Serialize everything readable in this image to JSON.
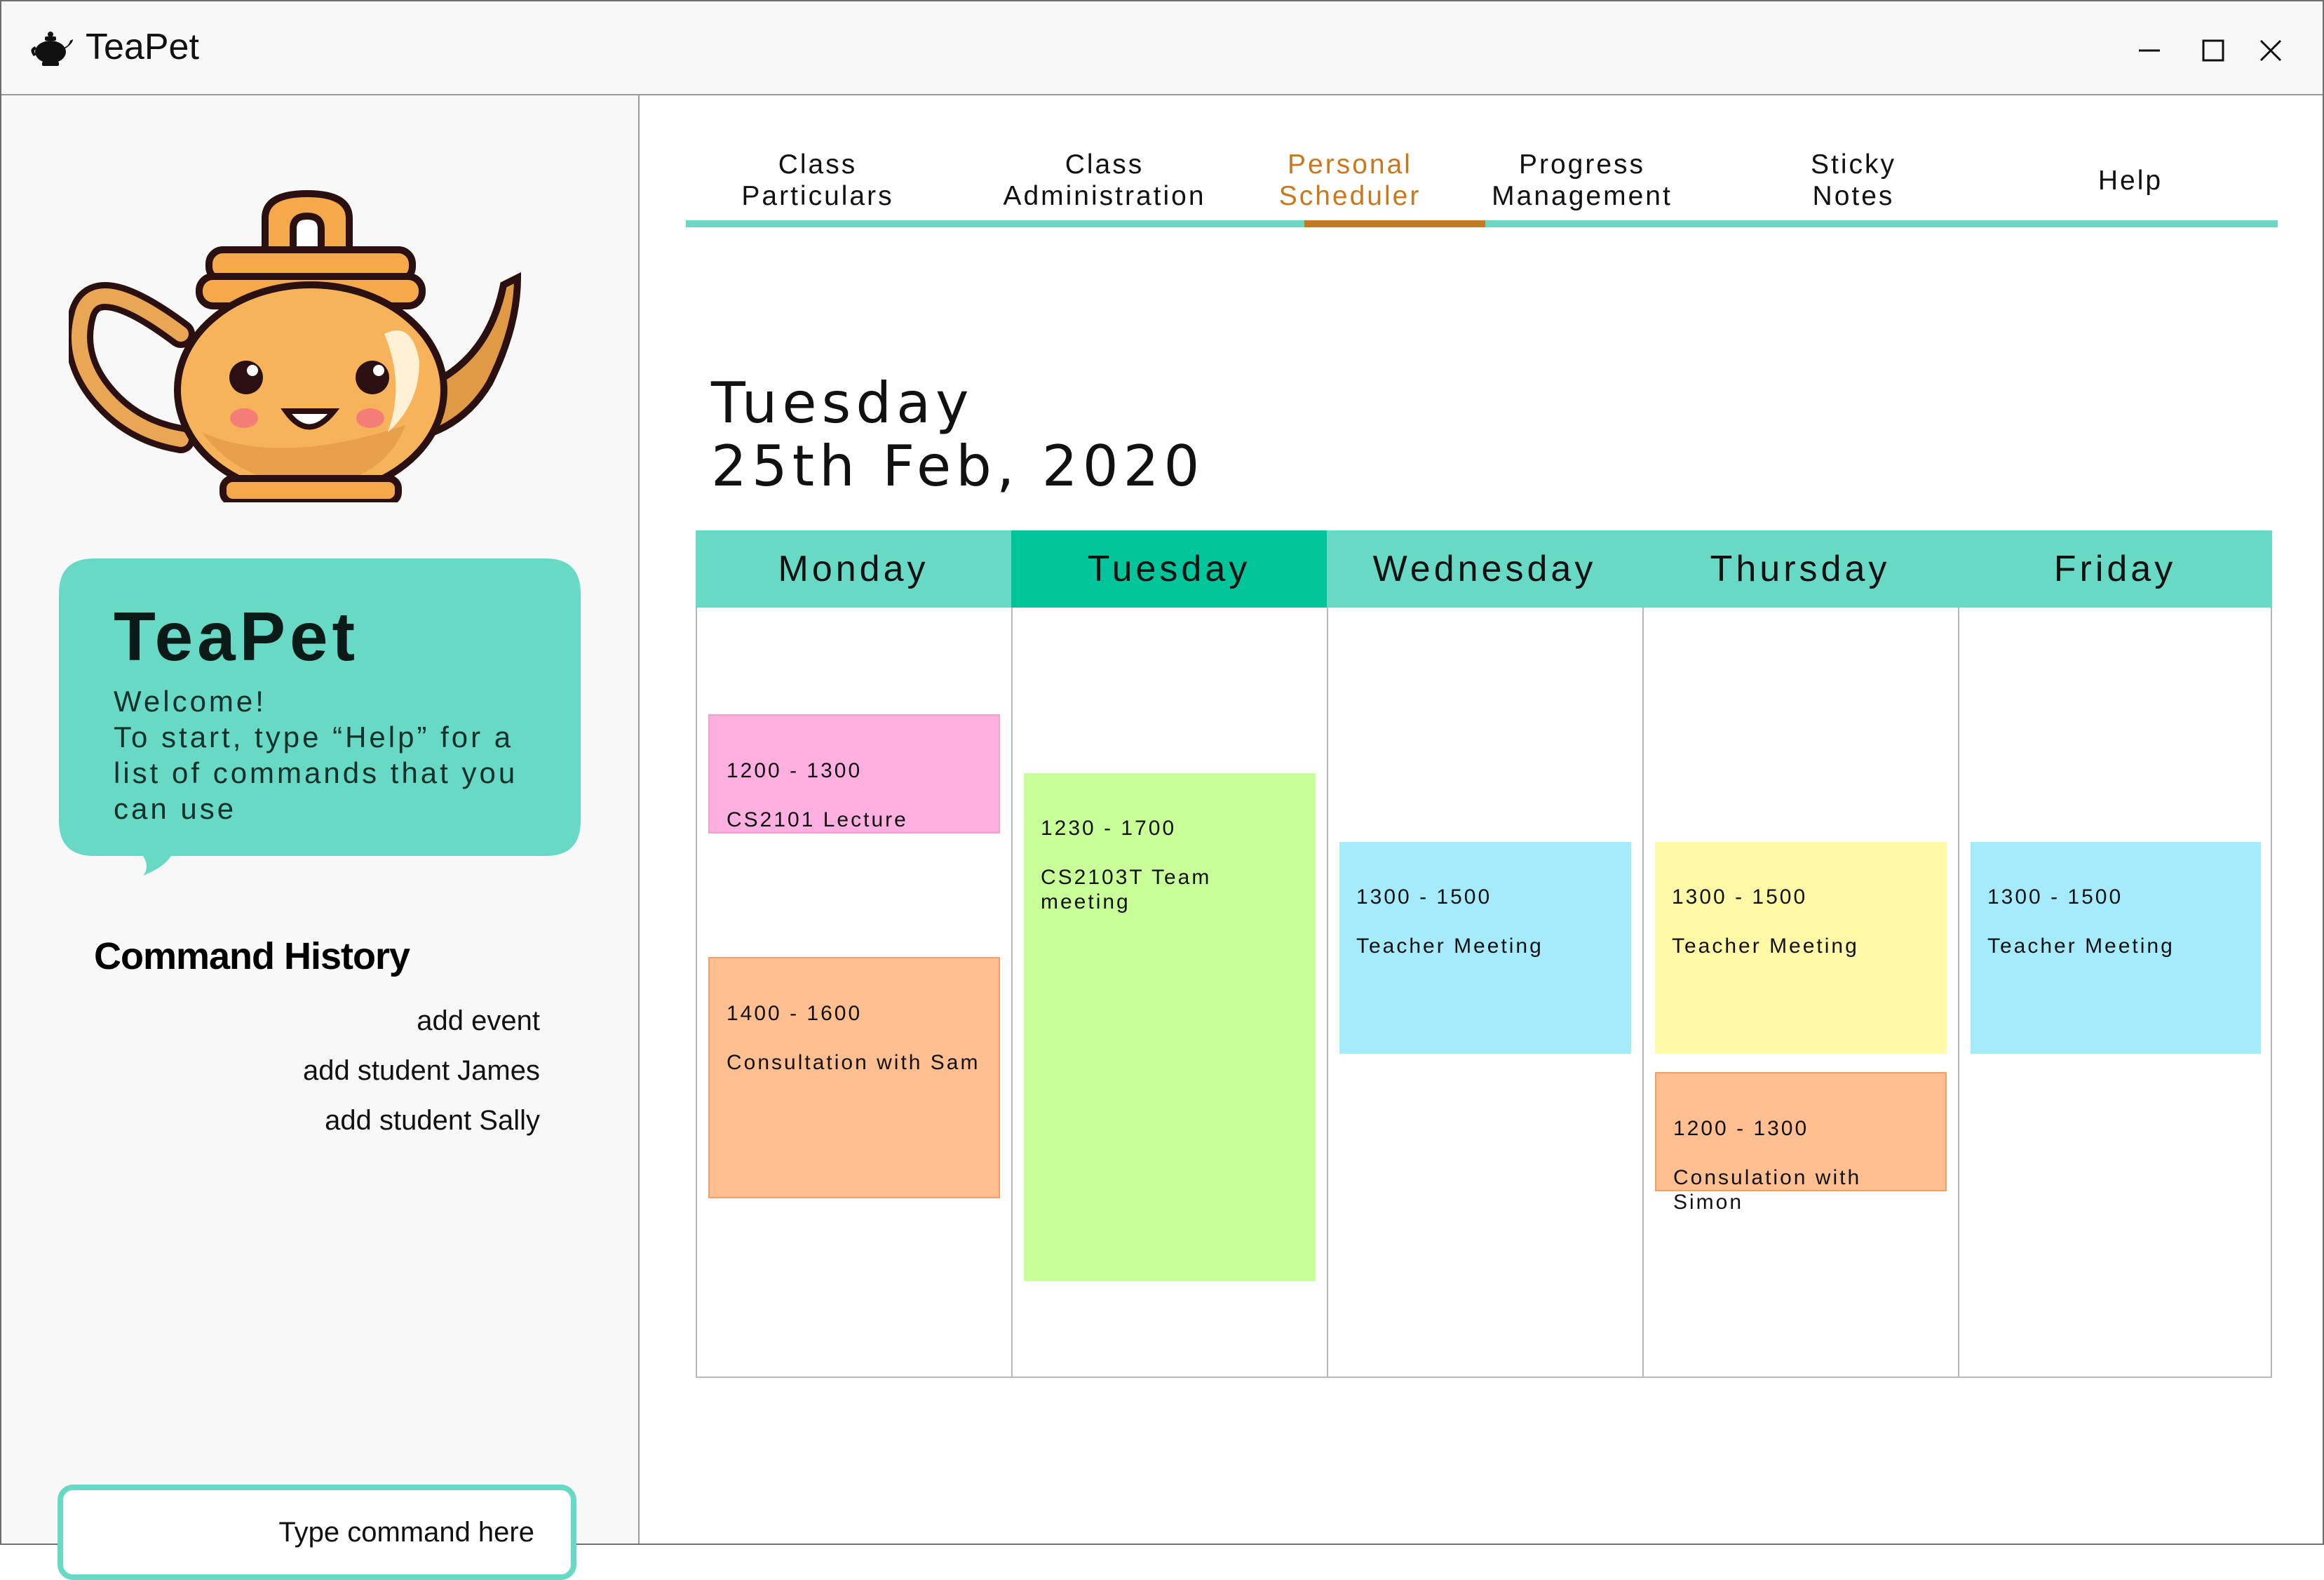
{
  "app": {
    "title": "TeaPet",
    "window_controls": [
      "minimize-icon",
      "maximize-icon",
      "close-icon"
    ]
  },
  "sidebar": {
    "bubble": {
      "title": "TeaPet",
      "message": "Welcome!\nTo start, type “Help” for a list of commands that you can use"
    },
    "command_history": {
      "title": "Command History",
      "items": [
        "add event",
        "add student James",
        "add student Sally"
      ]
    },
    "command_input": {
      "placeholder": "Type command here",
      "value": ""
    }
  },
  "tabs": [
    {
      "label": "Class\nParticulars",
      "active": false
    },
    {
      "label": "Class\nAdministration",
      "active": false
    },
    {
      "label": "Personal\nScheduler",
      "active": true
    },
    {
      "label": "Progress\nManagement",
      "active": false
    },
    {
      "label": "Sticky\nNotes",
      "active": false
    },
    {
      "label": "Help",
      "active": false
    }
  ],
  "scheduler": {
    "date_title": "Tuesday\n25th Feb, 2020",
    "days": [
      {
        "name": "Monday",
        "today": false,
        "events": [
          {
            "time": "1200 - 1300",
            "title": "CS2101 Lecture",
            "color": "#ffb0e0"
          },
          {
            "time": "1400 - 1600",
            "title": "Consultation with Sam",
            "color": "#ffbf91"
          }
        ]
      },
      {
        "name": "Tuesday",
        "today": true,
        "events": [
          {
            "time": "1230 - 1700",
            "title": "CS2103T Team\nmeeting",
            "color": "#c8ff98"
          }
        ]
      },
      {
        "name": "Wednesday",
        "today": false,
        "events": [
          {
            "time": "1300 - 1500",
            "title": "Teacher Meeting",
            "color": "#a5ebfc"
          }
        ]
      },
      {
        "name": "Thursday",
        "today": false,
        "events": [
          {
            "time": "1300 - 1500",
            "title": "Teacher Meeting",
            "color": "#fff9a8"
          },
          {
            "time": "1200 - 1300",
            "title": "Consulation with\nSimon",
            "color": "#ffbf91"
          }
        ]
      },
      {
        "name": "Friday",
        "today": false,
        "events": [
          {
            "time": "1300 - 1500",
            "title": "Teacher Meeting",
            "color": "#a5ebfc"
          }
        ]
      }
    ]
  },
  "colors": {
    "accent": "#68d9c4",
    "today_header": "#00c49a",
    "active_tab": "#c8781e"
  }
}
